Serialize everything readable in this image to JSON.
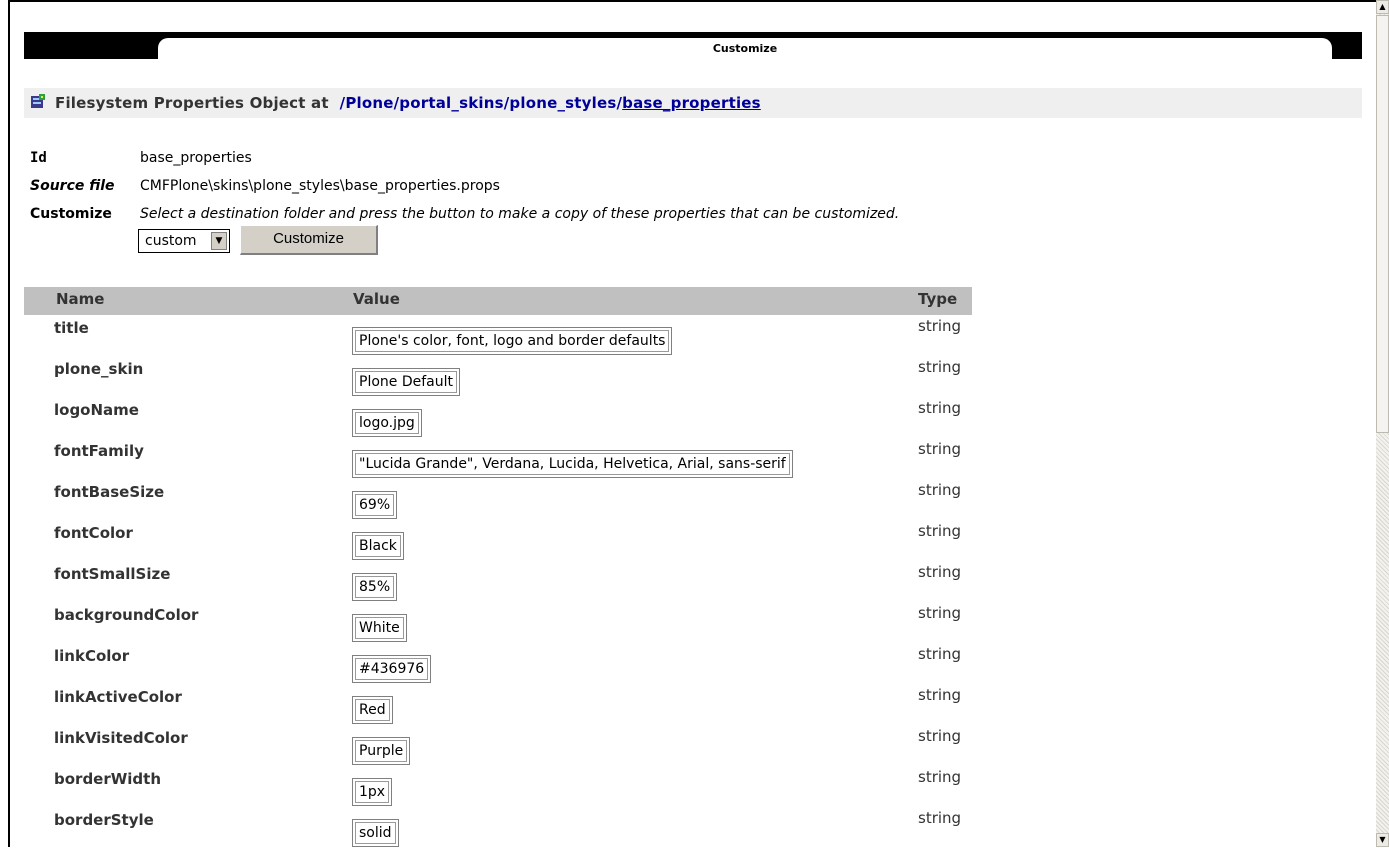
{
  "tab": {
    "label": "Customize"
  },
  "path": {
    "prefix": "Filesystem Properties Object at",
    "segments": [
      "Plone",
      "portal_skins",
      "plone_styles"
    ],
    "last": "base_properties"
  },
  "info": {
    "id_label": "Id",
    "id_value": "base_properties",
    "source_label": "Source file",
    "source_value": "CMFPlone\\skins\\plone_styles\\base_properties.props",
    "customize_label": "Customize",
    "customize_text": "Select a destination folder and press the button to make a copy of these properties that can be customized.",
    "folder_selected": "custom",
    "button_label": "Customize"
  },
  "table": {
    "headers": {
      "name": "Name",
      "value": "Value",
      "type": "Type"
    },
    "rows": [
      {
        "name": "title",
        "value": "Plone's color, font, logo and border defaults",
        "type": "string"
      },
      {
        "name": "plone_skin",
        "value": "Plone Default",
        "type": "string"
      },
      {
        "name": "logoName",
        "value": "logo.jpg",
        "type": "string"
      },
      {
        "name": "fontFamily",
        "value": "\"Lucida Grande\", Verdana, Lucida, Helvetica, Arial, sans-serif",
        "type": "string"
      },
      {
        "name": "fontBaseSize",
        "value": "69%",
        "type": "string"
      },
      {
        "name": "fontColor",
        "value": "Black",
        "type": "string"
      },
      {
        "name": "fontSmallSize",
        "value": "85%",
        "type": "string"
      },
      {
        "name": "backgroundColor",
        "value": "White",
        "type": "string"
      },
      {
        "name": "linkColor",
        "value": "#436976",
        "type": "string"
      },
      {
        "name": "linkActiveColor",
        "value": "Red",
        "type": "string"
      },
      {
        "name": "linkVisitedColor",
        "value": "Purple",
        "type": "string"
      },
      {
        "name": "borderWidth",
        "value": "1px",
        "type": "string"
      },
      {
        "name": "borderStyle",
        "value": "solid",
        "type": "string"
      }
    ]
  },
  "colors": {
    "link": "#000099",
    "header_bg": "#c0c0c0",
    "path_bg": "#efefef"
  }
}
